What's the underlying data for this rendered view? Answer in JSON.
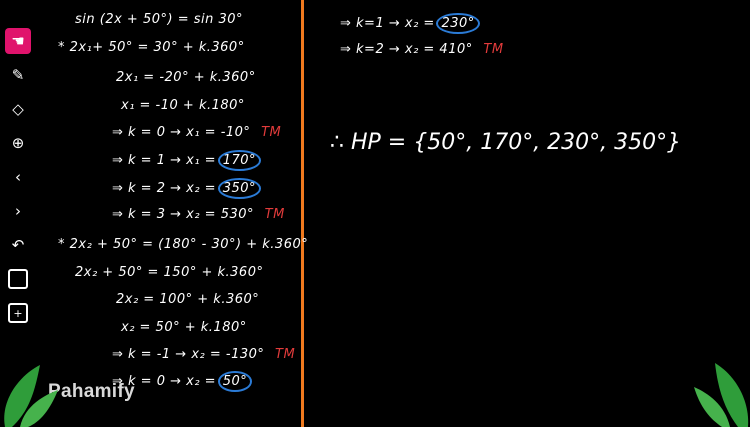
{
  "toolbar": {
    "icons": [
      "hand-icon",
      "pen-icon",
      "eraser-icon",
      "crosshair-icon",
      "prev-icon",
      "next-icon",
      "undo-icon",
      "square-icon",
      "zoom-in-icon"
    ]
  },
  "left": {
    "l1": "sin (2x + 50°) = sin 30°",
    "l2": "* 2x₁+ 50° = 30° + k.360°",
    "l3": "2x₁ = -20° + k.360°",
    "l4": "x₁ = -10 + k.180°",
    "l5a": "⇒ k = 0 → x₁ = -10°",
    "l5tm": "TM",
    "l6a": "⇒ k = 1 → x₁ =",
    "l6b": "170°",
    "l7a": "⇒ k = 2 → x₂ =",
    "l7b": "350°",
    "l8a": "⇒ k = 3 → x₂ = 530°",
    "l8tm": "TM",
    "l9": "* 2x₂ + 50° = (180° - 30°) + k.360°",
    "l10": "2x₂ + 50° = 150° + k.360°",
    "l11": "2x₂ = 100° + k.360°",
    "l12": "x₂ = 50° + k.180°",
    "l13a": "⇒ k = -1 → x₂ = -130°",
    "l13tm": "TM",
    "l14a": "⇒ k = 0 → x₂ =",
    "l14b": "50°"
  },
  "right": {
    "r1a": "⇒ k=1 → x₂ =",
    "r1b": "230°",
    "r2a": "⇒ k=2 → x₂ = 410°",
    "r2tm": "TM",
    "hp": "∴ HP = {50°, 170°, 230°, 350°}"
  },
  "logo": "Pahamify",
  "colors": {
    "background": "#000000",
    "divider": "#f07a1e",
    "active_tool": "#e0136c",
    "circle": "#2b7bd6",
    "tm_red": "#e23b3b"
  }
}
